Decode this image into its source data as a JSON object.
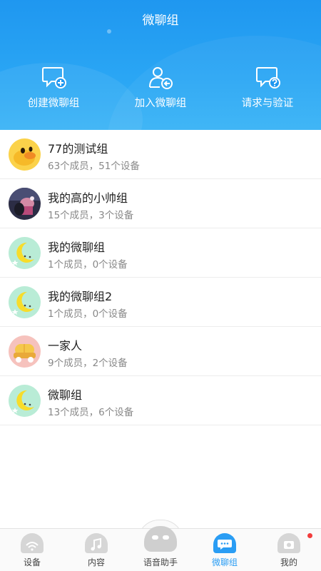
{
  "header": {
    "title": "微聊组",
    "actions": [
      {
        "label": "创建微聊组",
        "icon": "chat-add-icon"
      },
      {
        "label": "加入微聊组",
        "icon": "user-join-icon"
      },
      {
        "label": "请求与验证",
        "icon": "chat-question-icon"
      }
    ]
  },
  "groups": [
    {
      "name": "77的测试组",
      "meta": "63个成员，51个设备",
      "avatar": "duck-avatar"
    },
    {
      "name": "我的高的小帅组",
      "meta": "15个成员，3个设备",
      "avatar": "photo-avatar"
    },
    {
      "name": "我的微聊组",
      "meta": "1个成员，0个设备",
      "avatar": "moon-avatar"
    },
    {
      "name": "我的微聊组2",
      "meta": "1个成员，0个设备",
      "avatar": "moon-avatar"
    },
    {
      "name": "一家人",
      "meta": "9个成员，2个设备",
      "avatar": "family-avatar"
    },
    {
      "name": "微聊组",
      "meta": "13个成员，6个设备",
      "avatar": "moon-avatar"
    }
  ],
  "tabs": [
    {
      "label": "设备",
      "icon": "wifi-icon"
    },
    {
      "label": "内容",
      "icon": "music-icon"
    },
    {
      "label": "语音助手",
      "icon": "robot-icon"
    },
    {
      "label": "微聊组",
      "icon": "chat-bubble-icon",
      "active": true
    },
    {
      "label": "我的",
      "icon": "camera-icon",
      "badge": true
    }
  ],
  "colors": {
    "accent": "#2a9df4",
    "badge": "#f23c3c",
    "header": "#1f97f0"
  }
}
